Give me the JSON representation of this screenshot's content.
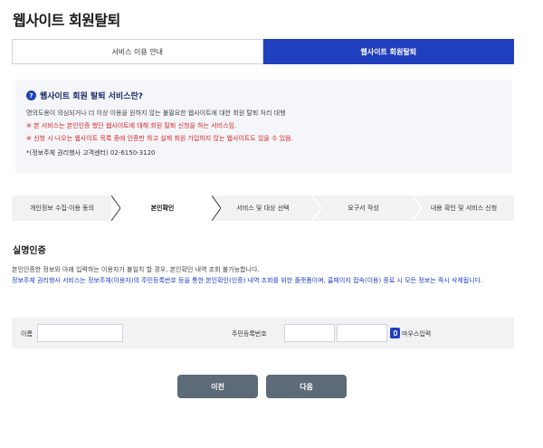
{
  "page": {
    "title": "웹사이트 회원탈퇴"
  },
  "tabs": [
    {
      "label": "서비스 이용 안내",
      "active": false
    },
    {
      "label": "웹사이트 회원탈퇴",
      "active": true
    }
  ],
  "info": {
    "title": "웹사이트 회원 탈퇴 서비스란?",
    "icon_text": "?",
    "lines": [
      "명의도용이 의심되거나 더 이상 이용을 원하지 않는 불필요한 웹사이트에 대한 회원 탈퇴 처리 대행",
      "※ 본 서비스는 본인인증 했던 웹사이트에 대해 회원 탈퇴 신청을 하는 서비스임.",
      "※ 신청 시 나오는 웹사이트 목록 중에 인증만 하고 실제 회원 가입하지 않는 웹사이트도 있을 수 있음."
    ],
    "contact": "*(정보주체 권리행사 고객센터) 02-6150-3120"
  },
  "steps": [
    {
      "label": "개인정보 수집·이용 동의",
      "active": false
    },
    {
      "label": "본인확인",
      "active": true
    },
    {
      "label": "서비스 및 대상 선택",
      "active": false
    },
    {
      "label": "요구서 작성",
      "active": false
    },
    {
      "label": "내용 확인 및 서비스 신청",
      "active": false
    }
  ],
  "section": {
    "title": "실명인증",
    "desc1": "본인인증한 정보와 아래 입력하는 이용자가 불일치 할 경우, 본인확인 내역 조회 불가능합니다.",
    "desc2": "정보주체 권리행사 서비스는 정보주체(이용자)의 주민등록번호 등을 통한 본인확인(인증) 내역 조회를 위한 플랫폼이며, 홈페이지 접속(이용) 종료 시 모든 정보는 즉시 삭제됩니다."
  },
  "form": {
    "name_label": "이름",
    "name_value": "",
    "rrn_label": "주민등록번호",
    "rrn_front_value": "",
    "rrn_back_value": "",
    "mouse_input_label": "마우스입력"
  },
  "buttons": {
    "prev": "이전",
    "next": "다음"
  },
  "colors": {
    "accent": "#1f3fbf",
    "warn": "#d6262b",
    "button": "#5d6a78"
  }
}
